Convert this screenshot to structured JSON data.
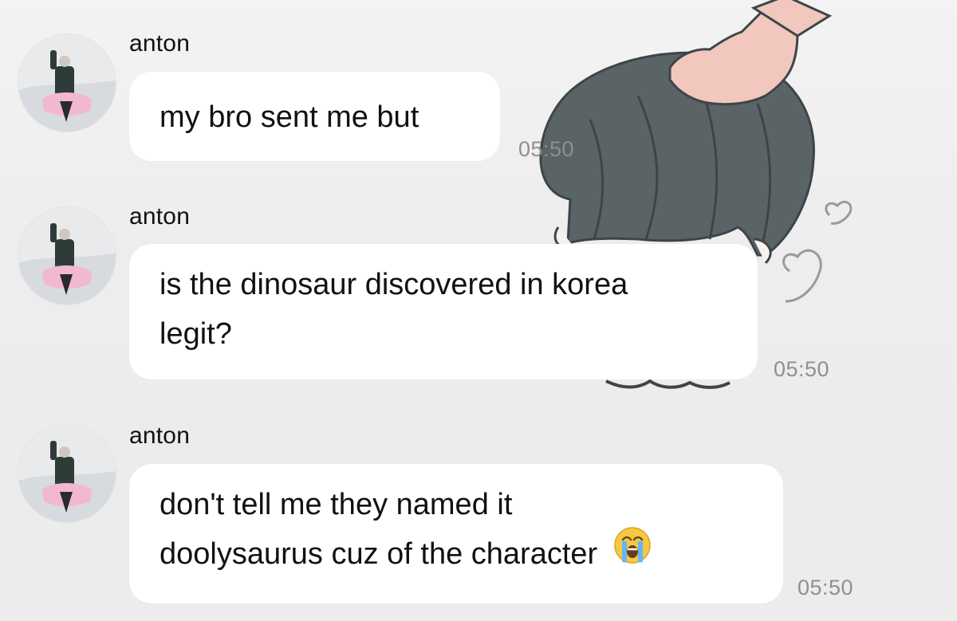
{
  "colors": {
    "background": "#efefef",
    "bubble": "#ffffff",
    "text": "#111111",
    "timestamp": "#8f8f8f",
    "sticker_hair": "#5a6366",
    "sticker_hand": "#f2c7bd"
  },
  "sticker": {
    "icon": "boy-head-pat-sticker-icon",
    "timestamp": "05:50"
  },
  "messages": [
    {
      "sender": "anton",
      "avatar_icon": "snowmobile-avatar-icon",
      "lines": [
        "my bro sent me but"
      ],
      "timestamp": "05:50"
    },
    {
      "sender": "anton",
      "avatar_icon": "snowmobile-avatar-icon",
      "lines": [
        "is the dinosaur discovered in korea",
        "legit?"
      ],
      "timestamp": "05:50"
    },
    {
      "sender": "anton",
      "avatar_icon": "snowmobile-avatar-icon",
      "lines": [
        "don't tell me they named it",
        "doolysaurus cuz of the character"
      ],
      "emoji_icon": "loudly-crying-face-icon",
      "timestamp": "05:50"
    }
  ]
}
